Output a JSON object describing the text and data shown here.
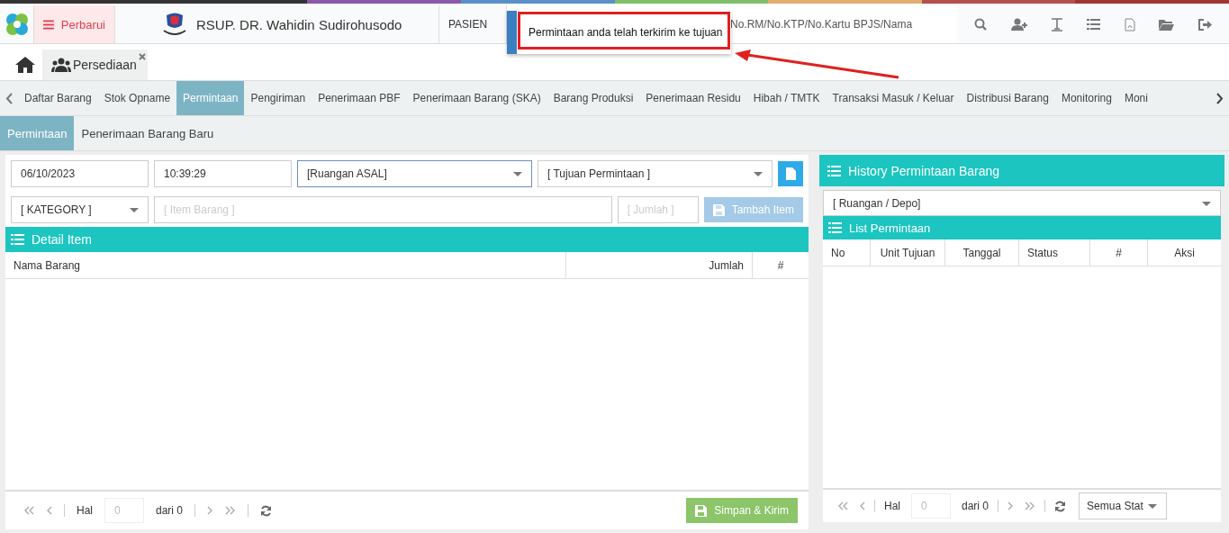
{
  "header": {
    "menu_button": "Perbarui",
    "hospital_name": "RSUP. DR. Wahidin Sudirohusodo",
    "section_label": "PASIEN",
    "search": {
      "placeholder": "No.RM/No.KTP/No.Kartu BPJS/Nama"
    }
  },
  "toast": {
    "message": "Permintaan anda telah terkirim ke tujuan"
  },
  "module_tabs": [
    {
      "label": "Persediaan",
      "selected": true
    }
  ],
  "nav_tabs": [
    {
      "label": "Daftar Barang",
      "selected": false
    },
    {
      "label": "Stok Opname",
      "selected": false
    },
    {
      "label": "Permintaan",
      "selected": true
    },
    {
      "label": "Pengiriman",
      "selected": false
    },
    {
      "label": "Penerimaan PBF",
      "selected": false
    },
    {
      "label": "Penerimaan Barang (SKA)",
      "selected": false
    },
    {
      "label": "Barang Produksi",
      "selected": false
    },
    {
      "label": "Penerimaan Residu",
      "selected": false
    },
    {
      "label": "Hibah / TMTK",
      "selected": false
    },
    {
      "label": "Transaksi Masuk / Keluar",
      "selected": false
    },
    {
      "label": "Distribusi Barang",
      "selected": false
    },
    {
      "label": "Monitoring",
      "selected": false
    },
    {
      "label": "Moni",
      "selected": false
    }
  ],
  "sub_tabs": [
    {
      "label": "Permintaan",
      "selected": true
    },
    {
      "label": "Penerimaan Barang Baru",
      "selected": false
    }
  ],
  "request_form": {
    "date": "06/10/2023",
    "time": "10:39:29",
    "origin_room": "[Ruangan ASAL]",
    "destination": "[ Tujuan Permintaan ]",
    "category": "[ KATEGORY ]",
    "item_placeholder": "[ Item Barang ]",
    "qty_placeholder": "[ Jumlah ]",
    "add_button": "Tambah Item",
    "add_button_disabled": true
  },
  "detail_panel": {
    "title": "Detail Item",
    "columns": [
      "Nama Barang",
      "Jumlah",
      "#"
    ],
    "pager": {
      "page_label": "Hal",
      "page_placeholder": "0",
      "of_label": "dari 0"
    },
    "submit_button": "Simpan & Kirim"
  },
  "history_panel": {
    "title": "History Permintaan Barang",
    "room_filter": "[ Ruangan / Depo]",
    "list_title": "List Permintaan",
    "columns": [
      "No",
      "Unit Tujuan",
      "Tanggal",
      "Status",
      "#",
      "Aksi"
    ],
    "pager": {
      "page_label": "Hal",
      "page_placeholder": "0",
      "of_label": "dari 0"
    },
    "status_filter": "Semua Stat"
  }
}
